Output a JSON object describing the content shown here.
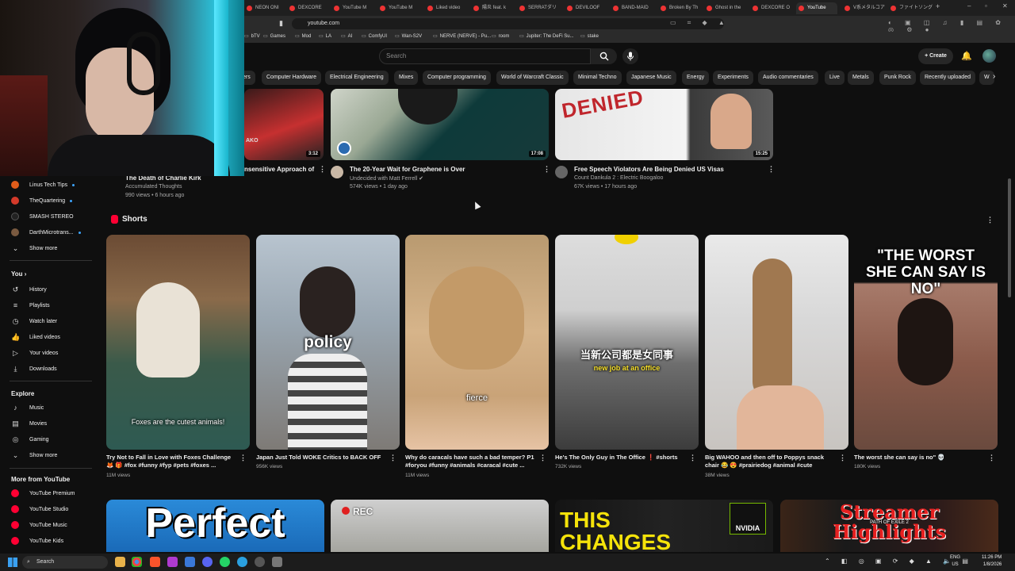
{
  "browser": {
    "tabs": [
      {
        "label": "NEON ONI"
      },
      {
        "label": "DEXCORE"
      },
      {
        "label": "YouTube M"
      },
      {
        "label": "YouTube M"
      },
      {
        "label": "Liked video"
      },
      {
        "label": "陽炎 feat. k"
      },
      {
        "label": "SERRATダリ"
      },
      {
        "label": "DEVILOOF"
      },
      {
        "label": "BAND-MAID"
      },
      {
        "label": "Broken By Th"
      },
      {
        "label": "Ghost in the"
      },
      {
        "label": "DEXCORE O"
      },
      {
        "label": "YouTube",
        "active": true
      },
      {
        "label": "V系メタルコア"
      },
      {
        "label": "ファイトソング"
      }
    ],
    "url": "youtube.com",
    "bookmarks": [
      "bTV",
      "Games",
      "Mod",
      "LA",
      "AI",
      "ComfyUI",
      "Wan-S2V",
      "NERVE (NERVE) - Pu...",
      "room",
      "Jupiter: The DeFi Su...",
      "stake"
    ]
  },
  "header": {
    "search_placeholder": "Search",
    "create_label": "Create"
  },
  "chips": [
    "ers",
    "Computer Hardware",
    "Electrical Engineering",
    "Mixes",
    "Computer programming",
    "World of Warcraft Classic",
    "Minimal Techno",
    "Japanese Music",
    "Energy",
    "Experiments",
    "Audio commentaries",
    "Live",
    "Metals",
    "Punk Rock",
    "Recently uploaded",
    "W"
  ],
  "sidebar": {
    "subscriptions": [
      {
        "label": "Linus Tech Tips",
        "color": "#e05c1a",
        "live": true
      },
      {
        "label": "TheQuartering",
        "color": "#d43a2a",
        "live": true
      },
      {
        "label": "SMASH STEREO",
        "color": "#222222",
        "live": false
      },
      {
        "label": "DarthMicrotrans...",
        "color": "#7a5a40",
        "live": true
      }
    ],
    "show_more_1": "Show more",
    "you_heading": "You",
    "you_items": [
      {
        "label": "History",
        "icon": "history-icon"
      },
      {
        "label": "Playlists",
        "icon": "playlist-icon"
      },
      {
        "label": "Watch later",
        "icon": "clock-icon"
      },
      {
        "label": "Liked videos",
        "icon": "thumbs-up-icon"
      },
      {
        "label": "Your videos",
        "icon": "video-icon"
      },
      {
        "label": "Downloads",
        "icon": "download-icon"
      }
    ],
    "explore_heading": "Explore",
    "explore_items": [
      {
        "label": "Music",
        "icon": "music-icon"
      },
      {
        "label": "Movies",
        "icon": "film-icon"
      },
      {
        "label": "Gaming",
        "icon": "gamepad-icon"
      }
    ],
    "show_more_2": "Show more",
    "more_heading": "More from YouTube",
    "more_items": [
      {
        "label": "YouTube Premium"
      },
      {
        "label": "YouTube Studio"
      },
      {
        "label": "YouTube Music"
      },
      {
        "label": "YouTube Kids"
      }
    ]
  },
  "videos_top": [
    {
      "title": "The Death of Charlie Kirk",
      "channel": "Accumulated Thoughts",
      "meta": "990 views • 6 hours ago",
      "duration": ""
    },
    {
      "title": "nsensitive Approach of",
      "channel": "",
      "meta": "",
      "duration": "3:12"
    },
    {
      "title": "The 20-Year Wait for Graphene is Over",
      "channel": "Undecided with Matt Ferrell",
      "meta": "574K views • 1 day ago",
      "duration": "17:08"
    },
    {
      "title": "Free Speech Violators Are Being Denied US Visas",
      "channel": "Count Dankula 2 : Electric Boogaloo",
      "meta": "67K views • 17 hours ago",
      "duration": "15:25"
    }
  ],
  "thumb_text": {
    "partial_left": "AKO",
    "denied": "DENIED"
  },
  "shorts": {
    "heading": "Shorts",
    "items": [
      {
        "title": "Try Not to Fall in Love with Foxes Challenge 🦊 🎁 #fox #funny #fyp #pets #foxes ...",
        "views": "11M views",
        "overlay": "Foxes are the cutest animals!"
      },
      {
        "title": "Japan Just Told WOKE Critics to BACK OFF",
        "views": "956K views",
        "overlay": "policy"
      },
      {
        "title": "Why do caracals have such a bad temper? P1 #foryou #funny #animals #caracal #cute ...",
        "views": "11M views",
        "overlay": "fierce"
      },
      {
        "title": "He's The Only Guy in The Office ❗ #shorts",
        "views": "732K views",
        "overlay": "当新公司都是女同事",
        "overlay2": "new job at an office"
      },
      {
        "title": "Big WAHOO and then off to Poppys snack chair 😂 😍 #prairiedog #animal #cute",
        "views": "38M views",
        "overlay": ""
      },
      {
        "title": "The worst she can say is no\" 💀",
        "views": "180K views",
        "overlay": "\"THE WORST SHE CAN SAY IS NO\""
      }
    ]
  },
  "bottom_row": [
    {
      "text": "Perfect"
    },
    {
      "text": "REC"
    },
    {
      "text": "THIS CHANGES",
      "badge": "NVIDIA"
    },
    {
      "text": "Streamer Highlights",
      "sub": "PATH OF EXILE 2"
    }
  ],
  "taskbar": {
    "search": "Search",
    "lang": "ENG",
    "region": "US",
    "time": "11:26 PM",
    "date": "1/8/2026"
  },
  "colors": {
    "bg": "#0f0f0f",
    "red": "#ff0033",
    "chip": "#272727",
    "accent": "#3ea6ff"
  }
}
